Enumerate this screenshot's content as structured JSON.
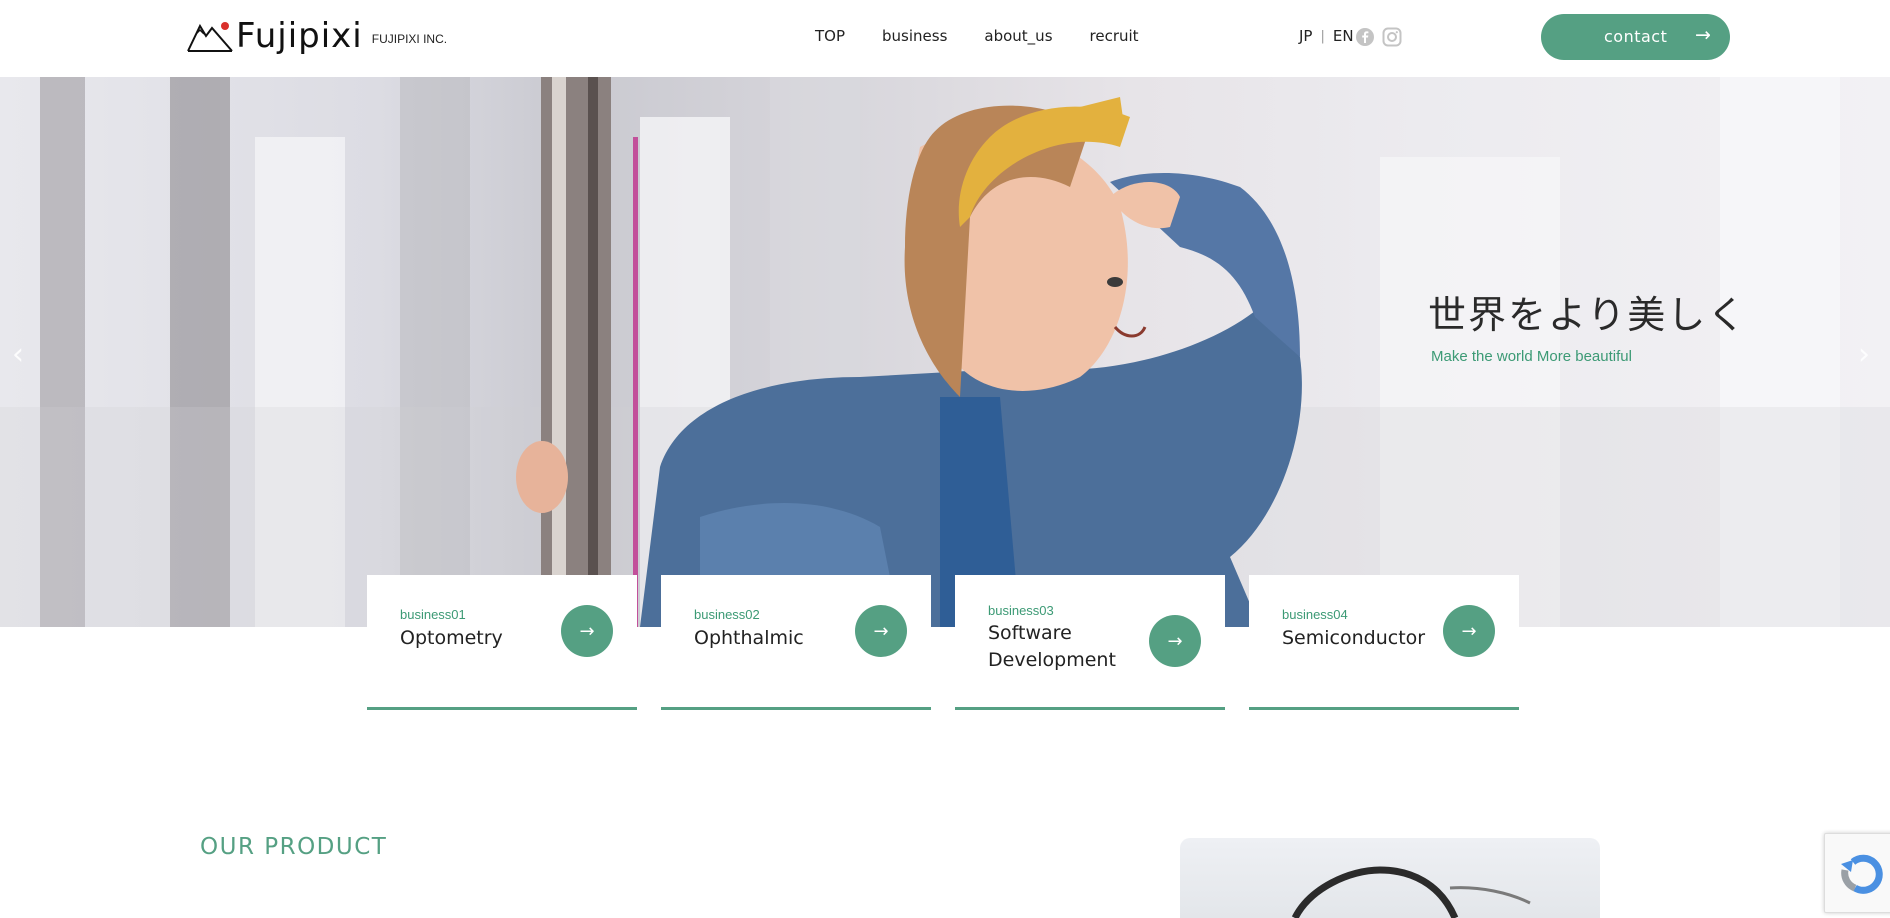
{
  "header": {
    "logo_text": "Fujipixi",
    "logo_sub": "FUJIPIXI INC.",
    "nav": [
      {
        "label": "TOP"
      },
      {
        "label": "business"
      },
      {
        "label": "about_us"
      },
      {
        "label": "recruit"
      }
    ],
    "lang": {
      "jp": "JP",
      "separator": "|",
      "en": "EN"
    },
    "social_icons": [
      "facebook-icon",
      "instagram-icon"
    ],
    "contact_label": "contact",
    "contact_arrow": "→"
  },
  "hero": {
    "title": "世界をより美しく",
    "subtitle": "Make the world More beautiful",
    "prev_arrow": "‹",
    "next_arrow": "›"
  },
  "business": [
    {
      "tag": "business01",
      "name": "Optometry",
      "arrow": "→"
    },
    {
      "tag": "business02",
      "name": "Ophthalmic",
      "arrow": "→"
    },
    {
      "tag": "business03",
      "name": "Software Development",
      "arrow": "→"
    },
    {
      "tag": "business04",
      "name": "Semiconductor",
      "arrow": "→"
    }
  ],
  "product": {
    "section_title": "OUR PRODUCT"
  },
  "colors": {
    "accent": "#55a083",
    "accent_text": "#3c9a75"
  }
}
